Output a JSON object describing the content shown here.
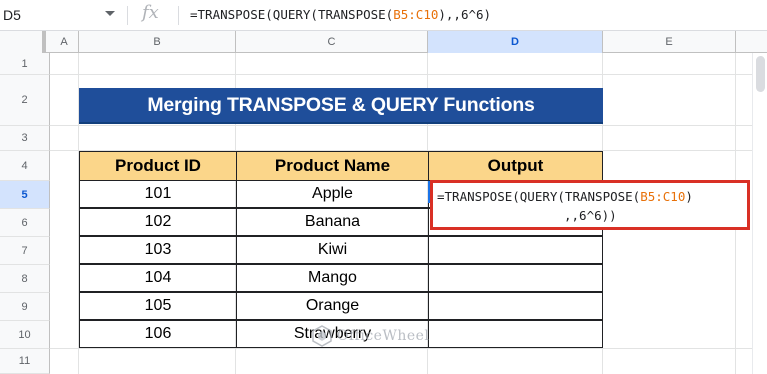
{
  "formula_bar": {
    "name_box": "D5",
    "fx_label": "fx",
    "formula_prefix": "=TRANSPOSE(",
    "formula_paren1": "(",
    "formula_mid": "QUERY(TRANSPOSE(",
    "formula_ref": "B5:C10",
    "formula_suffix": "),,6^6)",
    "formula_paren2": ")"
  },
  "columns": [
    "A",
    "B",
    "C",
    "D",
    "E"
  ],
  "rows": [
    "1",
    "2",
    "3",
    "4",
    "5",
    "6",
    "7",
    "8",
    "9",
    "10",
    "11"
  ],
  "active_cell": {
    "column": "D",
    "row": "5"
  },
  "title": "Merging TRANSPOSE & QUERY Functions",
  "table": {
    "headers": [
      "Product ID",
      "Product Name",
      "Output"
    ],
    "rows": [
      {
        "id": "101",
        "name": "Apple"
      },
      {
        "id": "102",
        "name": "Banana"
      },
      {
        "id": "103",
        "name": "Kiwi"
      },
      {
        "id": "104",
        "name": "Mango"
      },
      {
        "id": "105",
        "name": "Orange"
      },
      {
        "id": "106",
        "name": "Strawberry"
      }
    ]
  },
  "cell_formula": {
    "line1_prefix": "=TRANSPOSE(QUERY(TRANSPOSE(",
    "line1_ref": "B5:C10",
    "line1_suffix": ")",
    "line2": ",,6^6))"
  },
  "watermark": "OfficeWheel",
  "colors": {
    "title_bg": "#1f4e9a",
    "header_bg": "#fbd68a",
    "highlight_border": "#d93025",
    "reference": "#e8710a",
    "selection": "#1a73e8"
  }
}
